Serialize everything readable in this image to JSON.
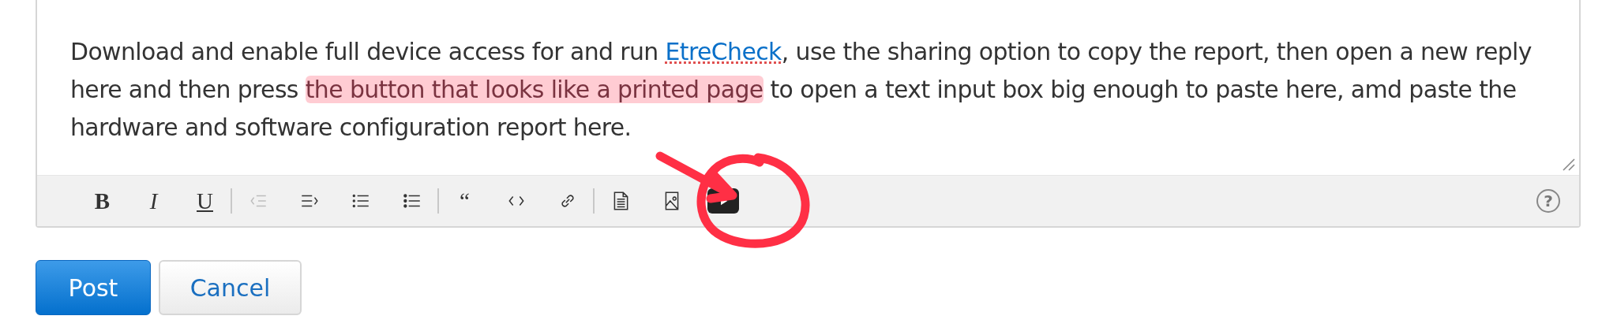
{
  "editor": {
    "paragraph": [
      {
        "kind": "text",
        "text": "Download and enable full device access for and run "
      },
      {
        "kind": "link",
        "text": "EtreCheck"
      },
      {
        "kind": "text",
        "text": ", use the sharing option to copy the report, then open a new reply here and then press "
      },
      {
        "kind": "highlight",
        "text": "the button that looks like a printed page"
      },
      {
        "kind": "text",
        "text": " to open a text input box big enough to paste here, amd paste the hardware and software configuration report here."
      }
    ],
    "toolbar": [
      {
        "kind": "bold",
        "label": "B",
        "disabled": false
      },
      {
        "kind": "italic",
        "label": "I",
        "disabled": false
      },
      {
        "kind": "underline",
        "label": "U",
        "disabled": false
      },
      {
        "kind": "separator"
      },
      {
        "kind": "outdent",
        "disabled": true
      },
      {
        "kind": "indent",
        "disabled": false
      },
      {
        "kind": "ordered-list",
        "disabled": false
      },
      {
        "kind": "bullet-list",
        "disabled": false
      },
      {
        "kind": "separator"
      },
      {
        "kind": "quote",
        "label": "“",
        "disabled": false
      },
      {
        "kind": "code",
        "disabled": false
      },
      {
        "kind": "link",
        "disabled": false
      },
      {
        "kind": "separator"
      },
      {
        "kind": "page",
        "disabled": false
      },
      {
        "kind": "image",
        "disabled": false
      },
      {
        "kind": "video",
        "disabled": false
      }
    ],
    "help": "?"
  },
  "buttons": [
    {
      "label": "Post",
      "kind": "primary"
    },
    {
      "label": "Cancel",
      "kind": "secondary"
    }
  ]
}
